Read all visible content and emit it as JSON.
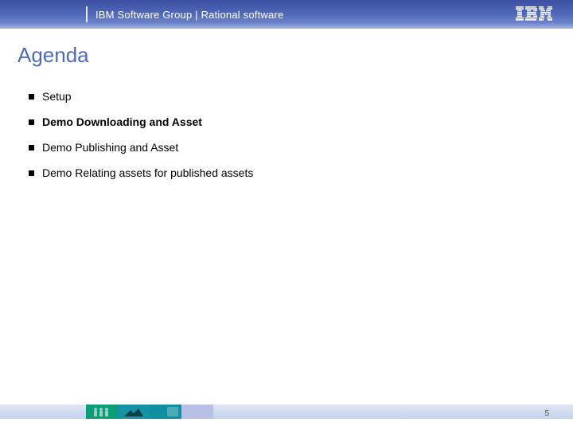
{
  "header": {
    "title": "IBM Software Group | Rational software"
  },
  "title": "Agenda",
  "items": [
    {
      "label": "Setup",
      "emph": false
    },
    {
      "label": "Demo Downloading and Asset",
      "emph": true
    },
    {
      "label": "Demo Publishing and Asset",
      "emph": false
    },
    {
      "label": "Demo Relating assets for published assets",
      "emph": false
    }
  ],
  "page_number": "5"
}
